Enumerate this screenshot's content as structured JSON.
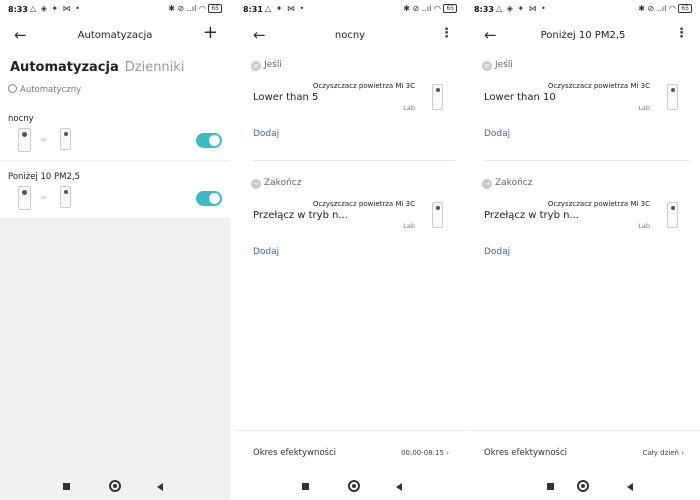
{
  "screen1": {
    "status": {
      "time": "8:33",
      "left_icons": "△ ◈ ✦ ⋈  •",
      "right_icons": "✱ ⊘ ..ıl ◠",
      "battery": "65"
    },
    "header": {
      "title": "Automatyzacja",
      "back_icon": "←",
      "add_icon": "+"
    },
    "tabs": {
      "active": "Automatyzacja",
      "inactive": "Dzienniki"
    },
    "subhead": "Automatyczny",
    "cards": [
      {
        "name": "nocny",
        "enabled": true
      },
      {
        "name": "Poniżej 10 PM2,5",
        "enabled": true
      }
    ],
    "link_glyph": "∞"
  },
  "screen2": {
    "status": {
      "time": "8:31",
      "left_icons": "△ ✦ ⋈  •",
      "right_icons": "✱ ⊘ ..ıl ◠",
      "battery": "65"
    },
    "header": {
      "title": "nocny",
      "back_icon": "←",
      "more_icon": "⋮"
    },
    "if_section": {
      "label": "Jeśli",
      "icon": "≡"
    },
    "if_condition": "Lower than 5",
    "device_name": "Oczyszczacz powietrza Mi 3C",
    "device_room": "Lab",
    "add_label": "Dodaj",
    "then_section": {
      "label": "Zakończ",
      "icon": "→"
    },
    "then_action": "Przełącz w tryb n...",
    "period_label": "Okres efektywności",
    "period_value": "00:00-08:15"
  },
  "screen3": {
    "status": {
      "time": "8:33",
      "left_icons": "△ ◈ ✦ ⋈  •",
      "right_icons": "✱ ⊘ ..ıl ◠",
      "battery": "65"
    },
    "header": {
      "title": "Poniżej 10 PM2,5",
      "back_icon": "←",
      "more_icon": "⋮"
    },
    "if_section": {
      "label": "Jeśli",
      "icon": "≡"
    },
    "if_condition": "Lower than 10",
    "device_name": "Oczyszczacz powietrza Mi 3C",
    "device_room": "Lab",
    "add_label": "Dodaj",
    "then_section": {
      "label": "Zakończ",
      "icon": "→"
    },
    "then_action": "Przełącz w tryb n...",
    "period_label": "Okres efektywności",
    "period_value": "Cały dzień"
  },
  "chevron": "›"
}
